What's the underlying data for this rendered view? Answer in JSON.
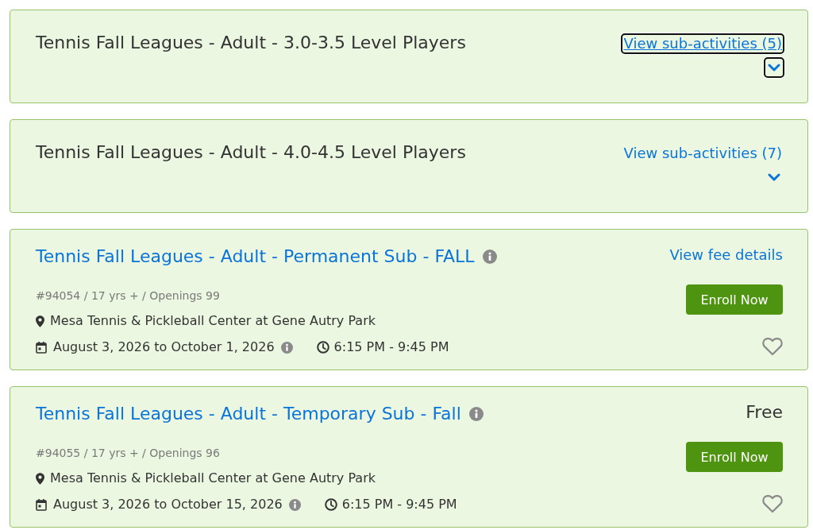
{
  "items": [
    {
      "kind": "group",
      "title": "Tennis Fall Leagues - Adult - 3.0-3.5 Level Players",
      "link": "View sub-activities (5)",
      "focused": true
    },
    {
      "kind": "group",
      "title": "Tennis Fall Leagues - Adult - 4.0-4.5 Level Players",
      "link": "View sub-activities (7)",
      "focused": false
    },
    {
      "kind": "activity",
      "title": "Tennis Fall Leagues - Adult - Permanent Sub - FALL",
      "meta": "#94054 / 17 yrs + / Openings 99",
      "location": "Mesa Tennis & Pickleball Center at Gene Autry Park",
      "dates": "August 3, 2026 to October 1, 2026",
      "time": "6:15 PM - 9:45 PM",
      "fee_link": "View fee details",
      "button": "Enroll Now",
      "favorited": false
    },
    {
      "kind": "activity",
      "title": "Tennis Fall Leagues - Adult - Temporary Sub - Fall",
      "meta": "#94055 / 17 yrs + / Openings 96",
      "location": "Mesa Tennis & Pickleball Center at Gene Autry Park",
      "dates": "August 3, 2026 to October 15, 2026",
      "time": "6:15 PM - 9:45 PM",
      "price": "Free",
      "button": "Enroll Now",
      "favorited": false
    }
  ]
}
